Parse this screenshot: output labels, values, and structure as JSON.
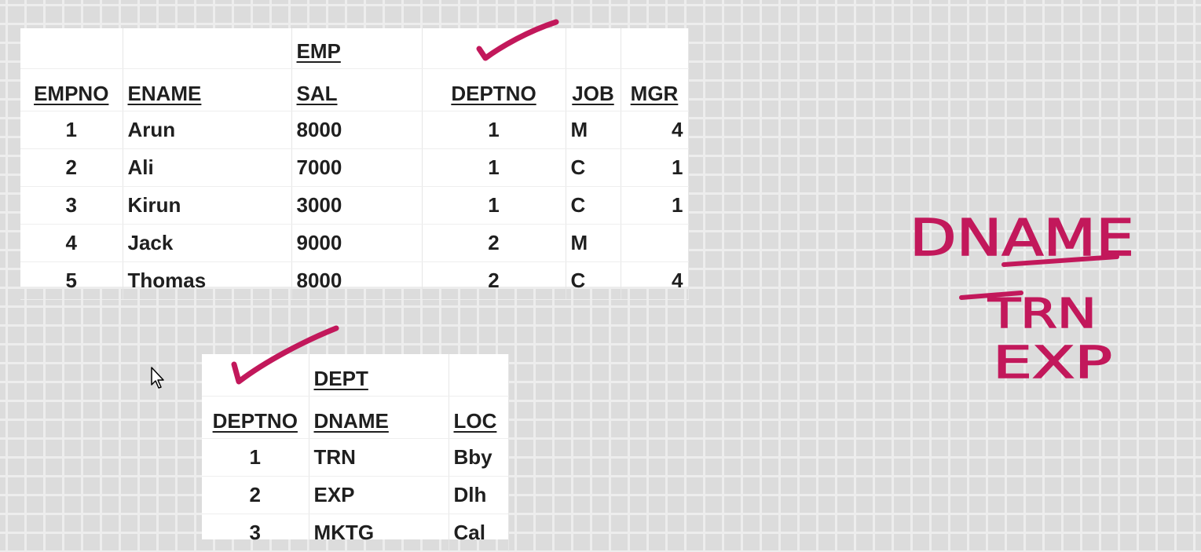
{
  "emp_table": {
    "title": "EMP",
    "columns": [
      "EMPNO",
      "ENAME",
      "SAL",
      "DEPTNO",
      "JOB",
      "MGR"
    ],
    "rows": [
      [
        "1",
        "Arun",
        "8000",
        "1",
        "M",
        "4"
      ],
      [
        "2",
        "Ali",
        "7000",
        "1",
        "C",
        "1"
      ],
      [
        "3",
        "Kirun",
        "3000",
        "1",
        "C",
        "1"
      ],
      [
        "4",
        "Jack",
        "9000",
        "2",
        "M",
        ""
      ],
      [
        "5",
        "Thomas",
        "8000",
        "2",
        "C",
        "4"
      ]
    ]
  },
  "dept_table": {
    "title": "DEPT",
    "columns": [
      "DEPTNO",
      "DNAME",
      "LOC"
    ],
    "rows": [
      [
        "1",
        "TRN",
        "Bby"
      ],
      [
        "2",
        "EXP",
        "Dlh"
      ],
      [
        "3",
        "MKTG",
        "Cal"
      ]
    ]
  },
  "annotations": {
    "handwriting": [
      "DNAME",
      "TRN",
      "EXP"
    ],
    "ink_color": "#c2185b"
  },
  "colors": {
    "grid_background": "#dcdcdc",
    "grid_lines": "#ededed",
    "sheet": "#ffffff",
    "text": "#1f1f1f"
  },
  "icons": [
    "checkmark-icon",
    "mouse-cursor-icon"
  ]
}
